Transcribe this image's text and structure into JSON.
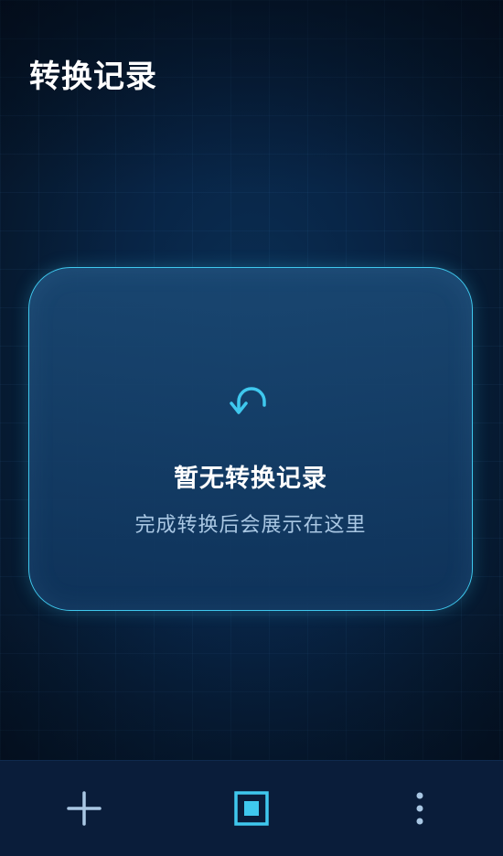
{
  "header": {
    "title": "转换记录"
  },
  "empty_state": {
    "icon": "undo-arrow-icon",
    "title": "暂无转换记录",
    "subtitle": "完成转换后会展示在这里"
  },
  "bottom_nav": {
    "items": [
      {
        "icon": "plus-icon",
        "active": false
      },
      {
        "icon": "square-record-icon",
        "active": true
      },
      {
        "icon": "more-vertical-icon",
        "active": false
      }
    ]
  },
  "colors": {
    "background": "#061a31",
    "accent": "#3fc8ee",
    "card_fill": "#12385f",
    "title_text": "#ffffff",
    "subtitle_text": "#a9c7e3",
    "nav_icon": "#a9c7e3",
    "bottom_bar": "#0a1d3a"
  }
}
